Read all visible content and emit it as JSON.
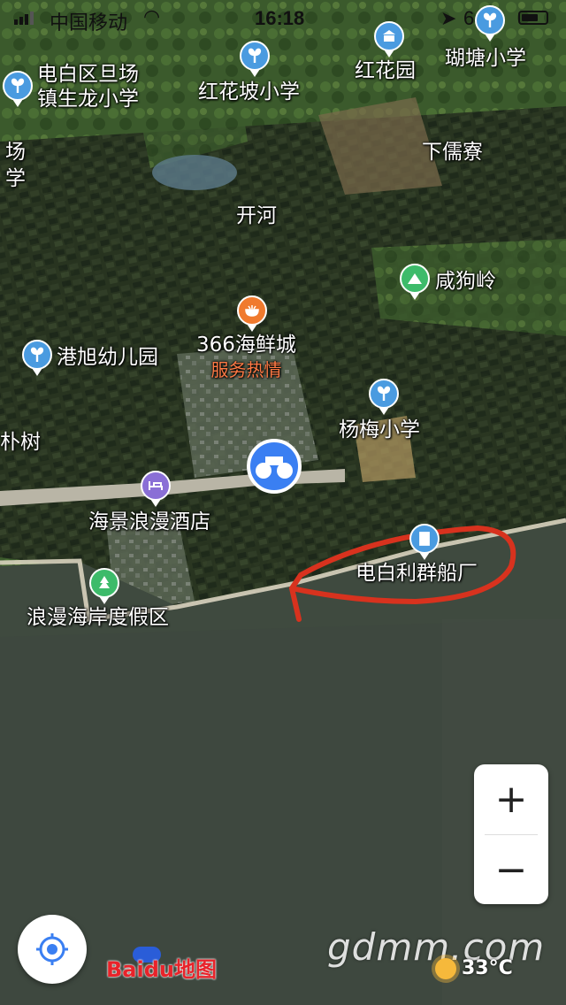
{
  "status_bar": {
    "carrier": "中国移动",
    "time": "16:18",
    "battery": "64%"
  },
  "map": {
    "places": [
      {
        "name": "电白区旦场",
        "line2": "镇生龙小学"
      },
      {
        "name": "红花坡小学"
      },
      {
        "name": "红花园"
      },
      {
        "name": "瑚塘小学"
      },
      {
        "name": "场"
      },
      {
        "name": "学"
      },
      {
        "name": "下儒寮"
      },
      {
        "name": "开河"
      },
      {
        "name": "咸狗岭"
      },
      {
        "name": "港旭幼儿园"
      },
      {
        "name": "366海鲜城",
        "sub": "服务热情"
      },
      {
        "name": "杨梅小学"
      },
      {
        "name": "朴树"
      },
      {
        "name": "海景浪漫酒店"
      },
      {
        "name": "电白利群船厂"
      },
      {
        "name": "浪漫海岸度假区"
      }
    ],
    "pin_colors": {
      "school": "#4a9be0",
      "building": "#4a9be0",
      "restaurant": "#f07a2e",
      "hotel": "#8a6fd6",
      "park": "#3dbb6a",
      "mountain": "#3dbb6a",
      "scenic": "#3a7ff2"
    },
    "annotation_color": "#d8321e"
  },
  "controls": {
    "zoom_in": "+",
    "zoom_out": "−"
  },
  "footer": {
    "baidu_logo_text": "Baidu地图",
    "watermark": "gdmm.com",
    "temperature": "33°C"
  }
}
